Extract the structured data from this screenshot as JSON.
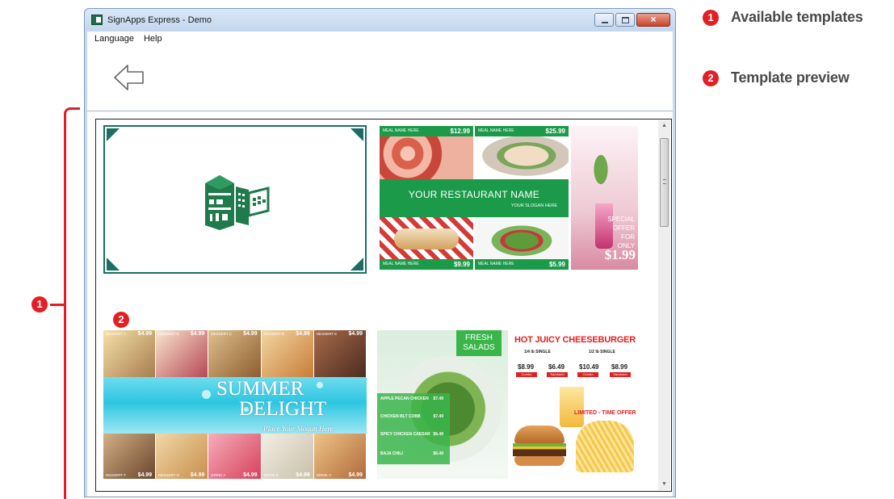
{
  "window": {
    "title": "SignApps Express - Demo",
    "close_glyph": "×"
  },
  "menu": {
    "items": [
      "Language",
      "Help"
    ]
  },
  "annotations": {
    "legend": [
      {
        "number": "1",
        "text": "Available templates"
      },
      {
        "number": "2",
        "text": "Template preview"
      }
    ],
    "bracket_label": "1",
    "preview_label": "2"
  },
  "templates": {
    "restaurant": {
      "meal_label": "MEAL NAME HERE",
      "prices": [
        "$12.99",
        "$25.99",
        "$9.99",
        "$5.99"
      ],
      "name": "YOUR RESTAURANT NAME",
      "slogan": "YOUR SLOGAN HERE",
      "offer_lines": [
        "SPECIAL",
        "OFFER",
        "FOR",
        "ONLY"
      ],
      "offer_price": "$1.99"
    },
    "summer": {
      "title_1": "SUMMER",
      "title_2": "DELIGHT",
      "slogan": "Place Your Slogan Here",
      "top_prices": [
        "$4.99",
        "$4.99",
        "$4.99",
        "$4.99",
        "$4.99"
      ],
      "bottom_prices": [
        "$4.99",
        "$4.99",
        "$4.99",
        "$4.99",
        "$4.99"
      ],
      "cell_labels": [
        "DESSERT A",
        "DESSERT B",
        "DESSERT C",
        "DESSERT D",
        "DESSERT E"
      ],
      "bottom_labels": [
        "DESSERT F",
        "DESSERT G",
        "DRINK A",
        "DRINK B",
        "DRINK C"
      ]
    },
    "burger": {
      "fresh": "FRESH",
      "salads": "SALADS",
      "salad_items": [
        {
          "name": "APPLE PECAN CHICKEN",
          "price": "$7.49"
        },
        {
          "name": "CHICKEN BLT COBB",
          "price": "$7.49"
        },
        {
          "name": "SPICY CHICKEN CAESAR",
          "price": "$6.49"
        },
        {
          "name": "BAJA CHILI",
          "price": "$6.49"
        }
      ],
      "title": "HOT JUICY CHEESEBURGER",
      "sizes": [
        "1/4 lb SINGLE",
        "1/2 lb SINGLE"
      ],
      "prices": [
        "$8.99",
        "$6.49",
        "$10.49",
        "$8.99"
      ],
      "tags": [
        "Combo",
        "Sandwich",
        "Combo",
        "Sandwich"
      ],
      "limited": "LIMITED - TIME OFFER"
    }
  },
  "icons": {
    "app": "app-icon",
    "back": "back-arrow-icon",
    "blank_template": "signapps-logo-icon"
  }
}
